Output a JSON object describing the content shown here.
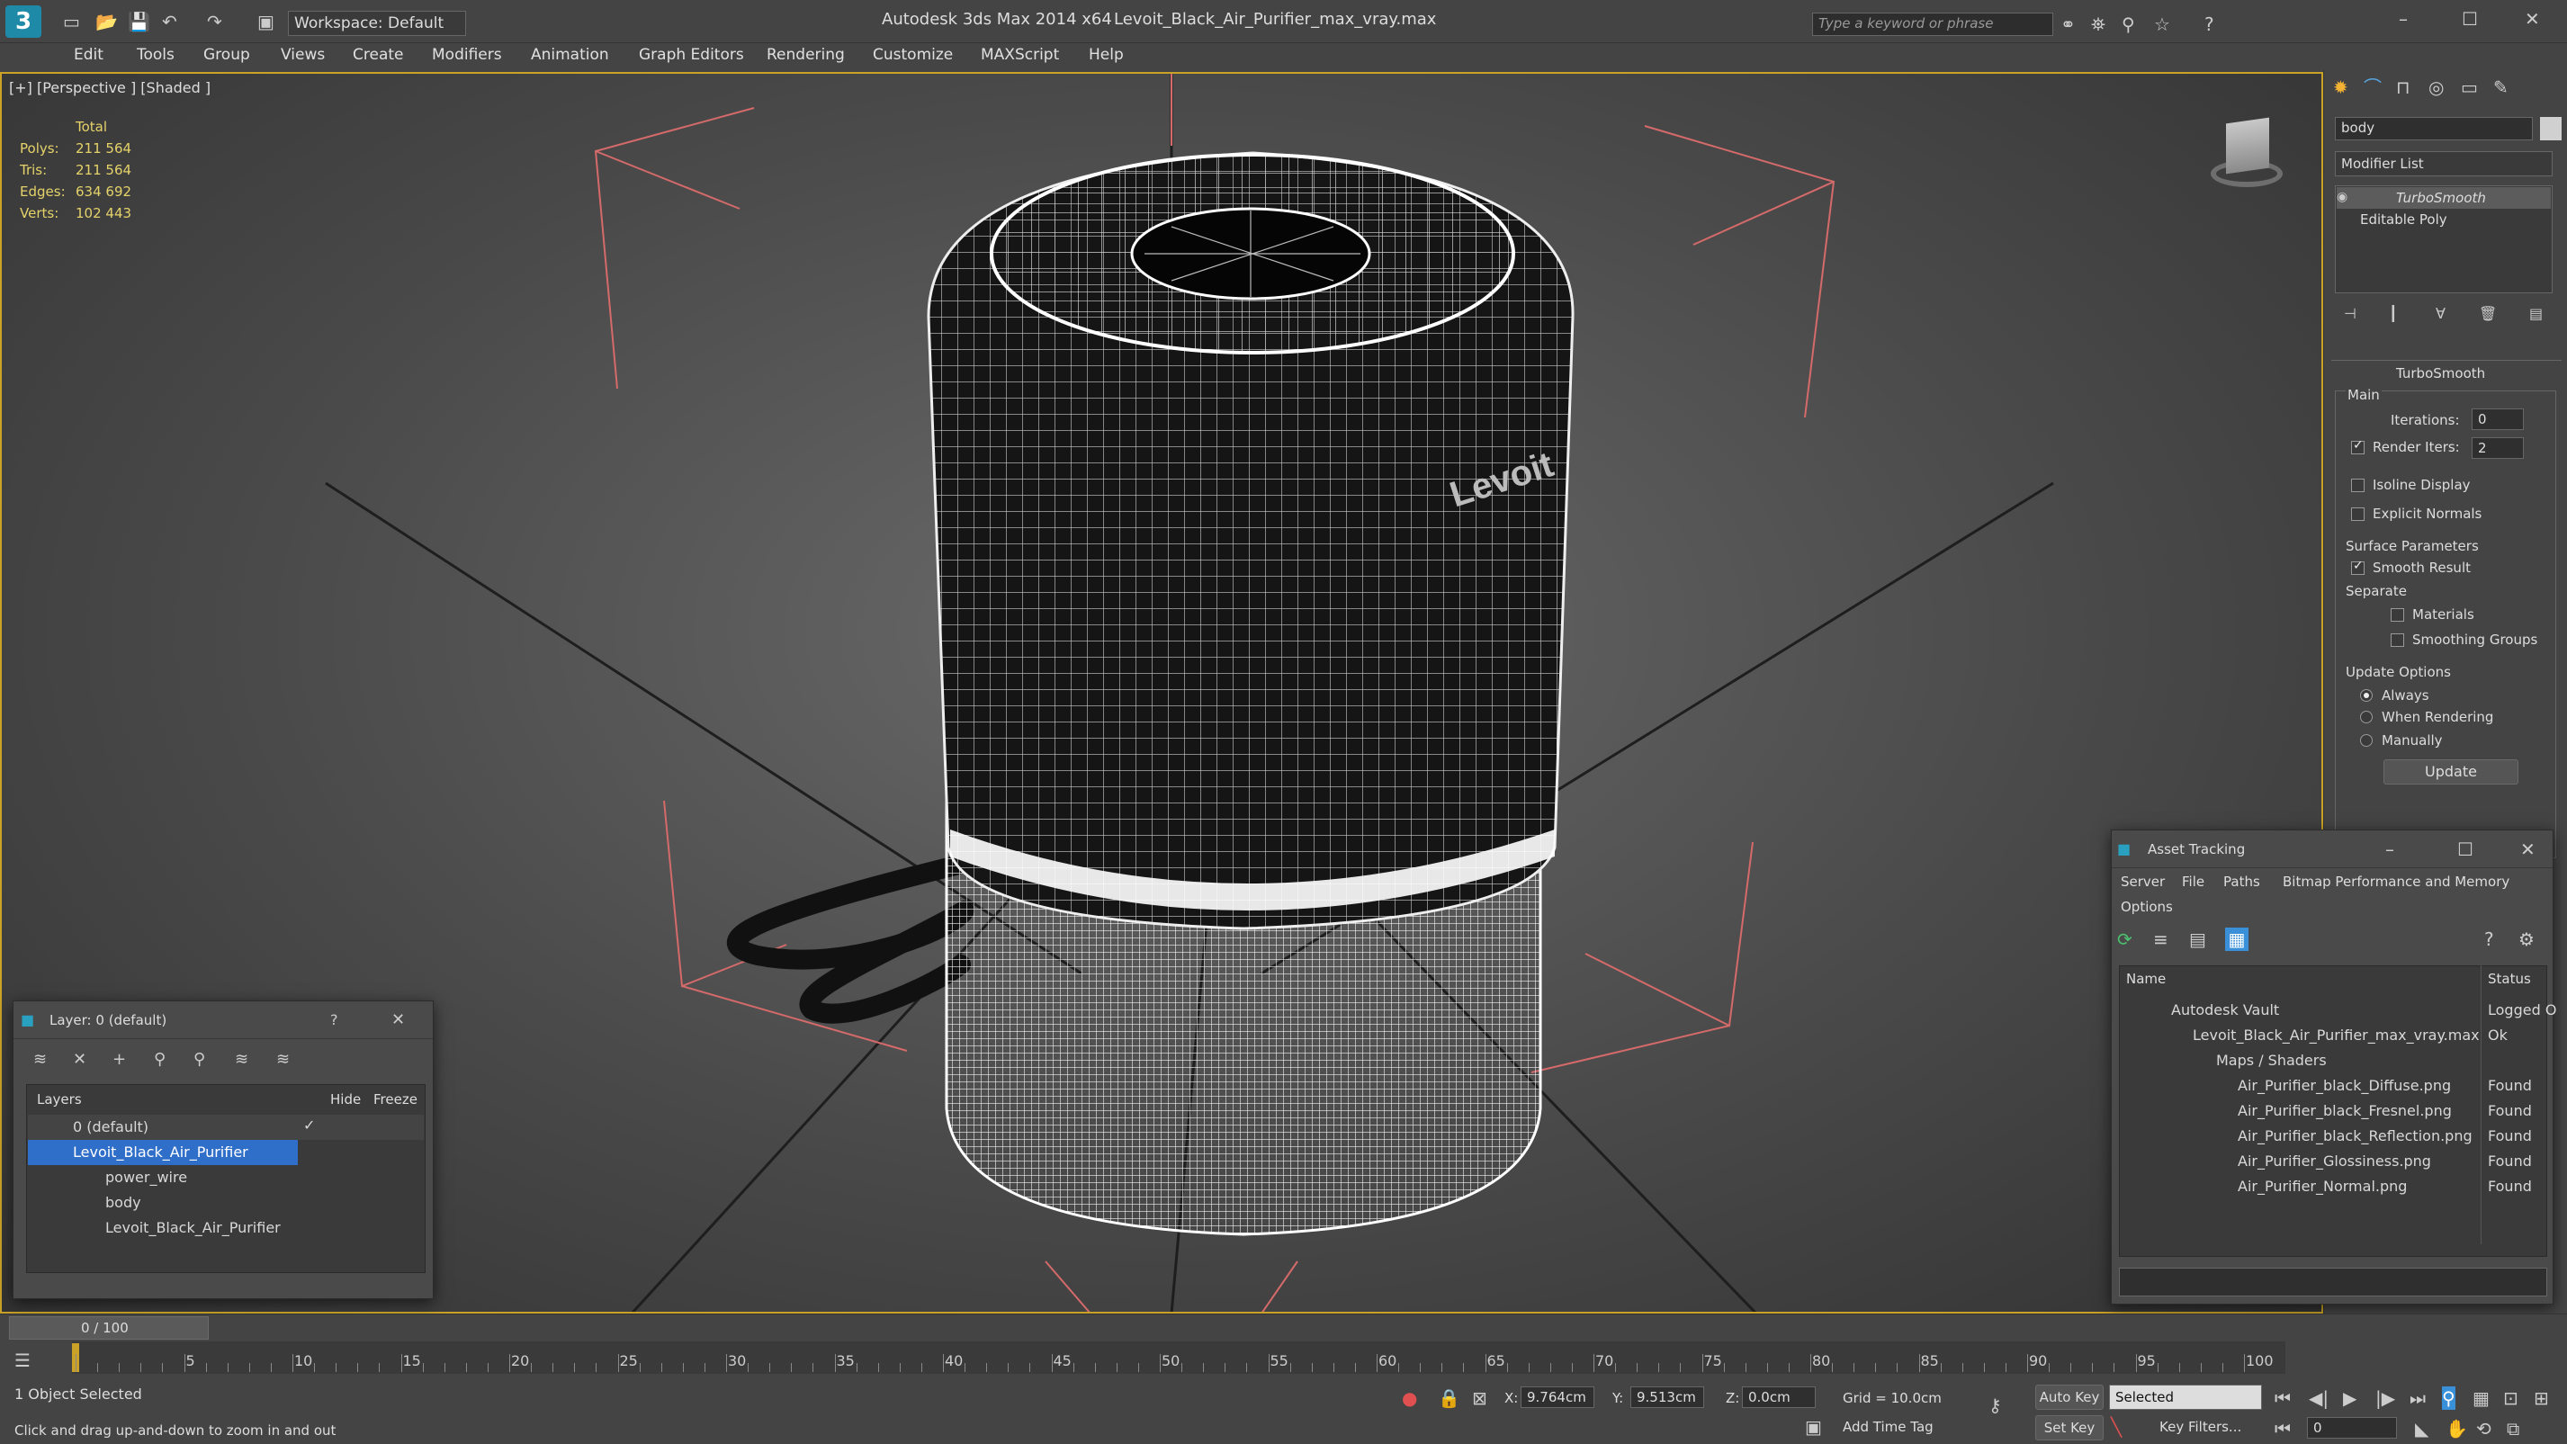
{
  "title_bar": {
    "workspace_label": "Workspace: Default",
    "app_title": "Autodesk 3ds Max  2014 x64",
    "file_name": "Levoit_Black_Air_Purifier_max_vray.max",
    "search_placeholder": "Type a keyword or phrase"
  },
  "menu": [
    "Edit",
    "Tools",
    "Group",
    "Views",
    "Create",
    "Modifiers",
    "Animation",
    "Graph Editors",
    "Rendering",
    "Customize",
    "MAXScript",
    "Help"
  ],
  "viewport": {
    "label": "[+] [Perspective ] [Shaded ]",
    "stats": {
      "header": "Total",
      "rows": [
        {
          "label": "Polys:",
          "value": "211 564"
        },
        {
          "label": "Tris:",
          "value": "211 564"
        },
        {
          "label": "Edges:",
          "value": "634 692"
        },
        {
          "label": "Verts:",
          "value": "102 443"
        }
      ]
    },
    "model_text": "Levoit"
  },
  "command_panel": {
    "object_name": "body",
    "modifier_list": "Modifier List",
    "stack": [
      "TurboSmooth",
      "Editable Poly"
    ],
    "rollout_title": "TurboSmooth",
    "main_label": "Main",
    "iterations_label": "Iterations:",
    "iterations_value": "0",
    "render_iters_label": "Render Iters:",
    "render_iters_value": "2",
    "isoline_label": "Isoline Display",
    "explicit_label": "Explicit Normals",
    "surface_label": "Surface Parameters",
    "smooth_label": "Smooth Result",
    "separate_label": "Separate",
    "materials_label": "Materials",
    "smoothing_groups_label": "Smoothing Groups",
    "update_options_label": "Update Options",
    "always_label": "Always",
    "when_rendering_label": "When Rendering",
    "manually_label": "Manually",
    "update_button": "Update"
  },
  "layer_window": {
    "title": "Layer: 0 (default)",
    "col_layers": "Layers",
    "col_hide": "Hide",
    "col_freeze": "Freeze",
    "rows": [
      "0 (default)",
      "Levoit_Black_Air_Purifier",
      "power_wire",
      "body",
      "Levoit_Black_Air_Purifier"
    ]
  },
  "asset_window": {
    "title": "Asset Tracking",
    "menu": [
      "Server",
      "File",
      "Paths",
      "Bitmap Performance and Memory"
    ],
    "menu2": "Options",
    "col_name": "Name",
    "col_status": "Status",
    "rows": [
      {
        "name": "Autodesk Vault",
        "status": "Logged O"
      },
      {
        "name": "Levoit_Black_Air_Purifier_max_vray.max",
        "status": "Ok"
      },
      {
        "name": "Maps / Shaders",
        "status": ""
      },
      {
        "name": "Air_Purifier_black_Diffuse.png",
        "status": "Found"
      },
      {
        "name": "Air_Purifier_black_Fresnel.png",
        "status": "Found"
      },
      {
        "name": "Air_Purifier_black_Reflection.png",
        "status": "Found"
      },
      {
        "name": "Air_Purifier_Glossiness.png",
        "status": "Found"
      },
      {
        "name": "Air_Purifier_Normal.png",
        "status": "Found"
      }
    ]
  },
  "timeline": {
    "frame_counter": "0 / 100",
    "ticks": [
      "5",
      "10",
      "15",
      "20",
      "25",
      "30",
      "35",
      "40",
      "45",
      "50",
      "55",
      "60",
      "65",
      "70",
      "75",
      "80",
      "85",
      "90",
      "95",
      "100"
    ]
  },
  "status": {
    "selection": "1 Object Selected",
    "prompt": "Click and drag up-and-down to zoom in and out",
    "x_label": "X:",
    "x_value": "9.764cm",
    "y_label": "Y:",
    "y_value": "9.513cm",
    "z_label": "Z:",
    "z_value": "0.0cm",
    "grid": "Grid = 10.0cm",
    "auto_key": "Auto Key",
    "selected_dropdown": "Selected",
    "set_key": "Set Key",
    "key_filters": "Key Filters...",
    "add_time_tag": "Add Time Tag",
    "frame_value": "0"
  }
}
